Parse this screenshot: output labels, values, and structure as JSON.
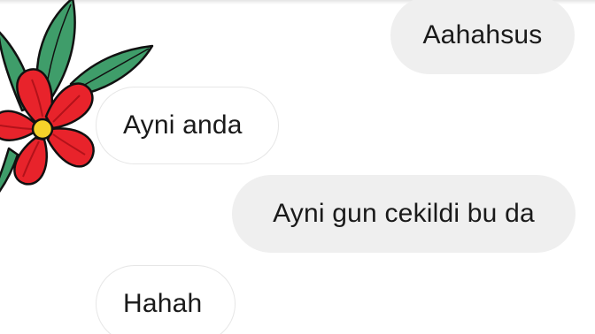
{
  "messages": [
    {
      "direction": "sent",
      "text": "Aahahsus"
    },
    {
      "direction": "received",
      "text": "Ayni anda"
    },
    {
      "direction": "sent",
      "text": "Ayni gun cekildi bu da"
    },
    {
      "direction": "received",
      "text": "Hahah"
    }
  ],
  "sticker": {
    "icon": "red-flower-icon"
  },
  "colors": {
    "sent_bubble": "#efefef",
    "received_bubble_border": "#e6e6e6",
    "petal": "#e8232b",
    "leaf": "#3f9d6a",
    "flower_center": "#f5d22a"
  }
}
